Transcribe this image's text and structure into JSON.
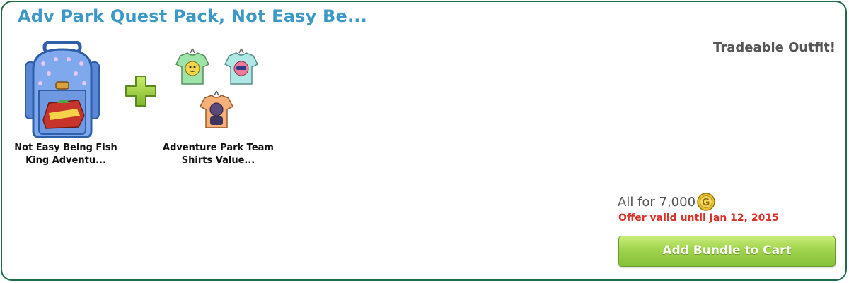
{
  "bundle": {
    "title": "Adv Park Quest Pack, Not Easy Be...",
    "tradeable_note": "Tradeable Outfit!",
    "items": [
      {
        "label_line1": "Not Easy Being Fish",
        "label_line2": "King Adventu...",
        "icon": "backpack-icon"
      },
      {
        "label_line1": "Adventure Park Team",
        "label_line2": "Shirts Value...",
        "icon": "team-shirts-icon"
      }
    ],
    "price_label": "All for 7,000",
    "currency_icon": "gold-coin-icon",
    "offer_text": "Offer valid until Jan 12, 2015",
    "cart_button_label": "Add Bundle to Cart"
  },
  "colors": {
    "title": "#3b98c7",
    "border": "#1f6b45",
    "offer": "#d9342b",
    "button_green": "#9fd44b"
  }
}
